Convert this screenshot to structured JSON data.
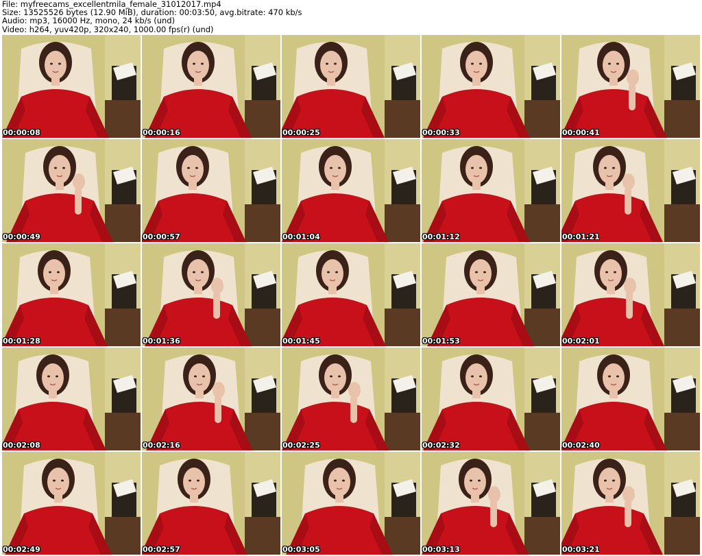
{
  "header": {
    "file_line": "File: myfreecams_excellentmila_female_31012017.mp4",
    "size_line": "Size: 13525526 bytes (12.90 MiB), duration: 00:03:50, avg.bitrate: 470 kb/s",
    "audio_line": "Audio: mp3, 16000 Hz, mono, 24 kb/s (und)",
    "video_line": "Video: h264, yuv420p, 320x240, 1000.00 fps(r) (und)"
  },
  "thumbnails": [
    {
      "timestamp": "00:00:08"
    },
    {
      "timestamp": "00:00:16"
    },
    {
      "timestamp": "00:00:25"
    },
    {
      "timestamp": "00:00:33"
    },
    {
      "timestamp": "00:00:41"
    },
    {
      "timestamp": "00:00:49"
    },
    {
      "timestamp": "00:00:57"
    },
    {
      "timestamp": "00:01:04"
    },
    {
      "timestamp": "00:01:12"
    },
    {
      "timestamp": "00:01:21"
    },
    {
      "timestamp": "00:01:28"
    },
    {
      "timestamp": "00:01:36"
    },
    {
      "timestamp": "00:01:45"
    },
    {
      "timestamp": "00:01:53"
    },
    {
      "timestamp": "00:02:01"
    },
    {
      "timestamp": "00:02:08"
    },
    {
      "timestamp": "00:02:16"
    },
    {
      "timestamp": "00:02:25"
    },
    {
      "timestamp": "00:02:32"
    },
    {
      "timestamp": "00:02:40"
    },
    {
      "timestamp": "00:02:49"
    },
    {
      "timestamp": "00:02:57"
    },
    {
      "timestamp": "00:03:05"
    },
    {
      "timestamp": "00:03:13"
    },
    {
      "timestamp": "00:03:21"
    }
  ],
  "colors": {
    "wall": "#cfc684",
    "chair": "#efe3cf",
    "dress": "#c8101a",
    "hair": "#3a2218",
    "skin": "#e9c2ab",
    "floor": "#5a3a22",
    "timestamp_text": "#ffffff"
  }
}
